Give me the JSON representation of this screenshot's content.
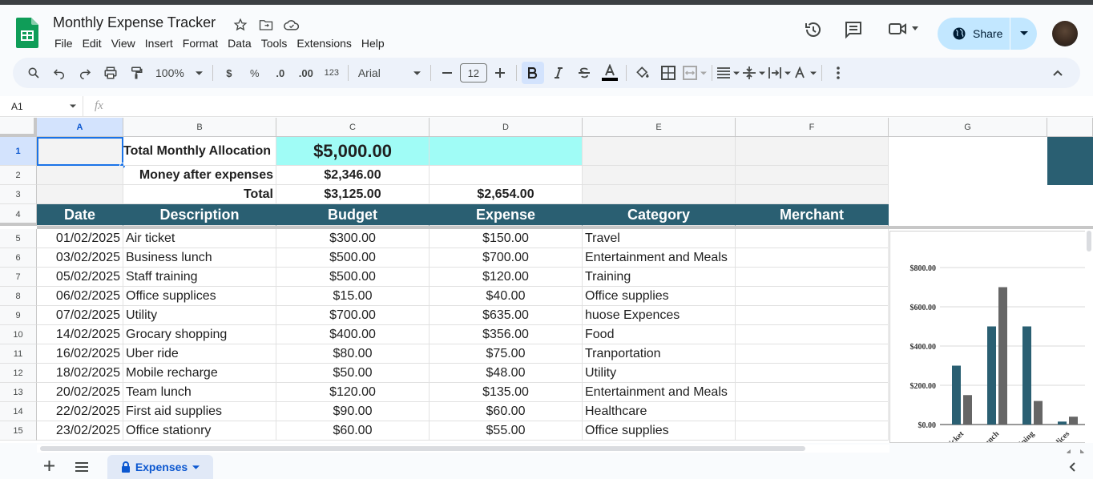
{
  "doc_title": "Monthly Expense Tracker",
  "menu": [
    "File",
    "Edit",
    "View",
    "Insert",
    "Format",
    "Data",
    "Tools",
    "Extensions",
    "Help"
  ],
  "share_label": "Share",
  "toolbar": {
    "zoom": "100%",
    "currency": "$",
    "percent": "%",
    "dec_dec": ".0",
    "inc_dec": ".00",
    "num_format": "123",
    "font": "Arial",
    "font_size": "12"
  },
  "formula_bar": {
    "name_box": "A1",
    "fx": "fx",
    "value": ""
  },
  "columns": [
    "A",
    "B",
    "C",
    "D",
    "E",
    "F",
    "G"
  ],
  "summary": [
    {
      "row": "1",
      "label": "Total Monthly Allocation",
      "c": "$5,000.00",
      "d": ""
    },
    {
      "row": "2",
      "label": "Money after expenses",
      "c": "$2,346.00",
      "d": ""
    },
    {
      "row": "3",
      "label": "Total",
      "c": "$3,125.00",
      "d": "$2,654.00"
    }
  ],
  "header_row": {
    "row": "4",
    "cells": [
      "Date",
      "Description",
      "Budget",
      "Expense",
      "Category",
      "Merchant"
    ]
  },
  "rows": [
    {
      "row": "5",
      "date": "01/02/2025",
      "desc": "Air ticket",
      "budget": "$300.00",
      "expense": "$150.00",
      "category": "Travel"
    },
    {
      "row": "6",
      "date": "03/02/2025",
      "desc": "Business lunch",
      "budget": "$500.00",
      "expense": "$700.00",
      "category": "Entertainment and Meals"
    },
    {
      "row": "7",
      "date": "05/02/2025",
      "desc": "Staff training",
      "budget": "$500.00",
      "expense": "$120.00",
      "category": "Training"
    },
    {
      "row": "8",
      "date": "06/02/2025",
      "desc": "Office supplices",
      "budget": "$15.00",
      "expense": "$40.00",
      "category": "Office supplies"
    },
    {
      "row": "9",
      "date": "07/02/2025",
      "desc": "Utility",
      "budget": "$700.00",
      "expense": "$635.00",
      "category": "huose Expences"
    },
    {
      "row": "10",
      "date": "14/02/2025",
      "desc": "Grocary shopping",
      "budget": "$400.00",
      "expense": "$356.00",
      "category": "Food"
    },
    {
      "row": "11",
      "date": "16/02/2025",
      "desc": "Uber ride",
      "budget": "$80.00",
      "expense": "$75.00",
      "category": "Tranportation"
    },
    {
      "row": "12",
      "date": "18/02/2025",
      "desc": "Mobile recharge",
      "budget": "$50.00",
      "expense": "$48.00",
      "category": "Utility"
    },
    {
      "row": "13",
      "date": "20/02/2025",
      "desc": "Team lunch",
      "budget": "$120.00",
      "expense": "$135.00",
      "category": "Entertainment and Meals"
    },
    {
      "row": "14",
      "date": "22/02/2025",
      "desc": "First aid supplies",
      "budget": "$90.00",
      "expense": "$60.00",
      "category": "Healthcare"
    },
    {
      "row": "15",
      "date": "23/02/2025",
      "desc": "Office stationry",
      "budget": "$60.00",
      "expense": "$55.00",
      "category": "Office supplies"
    }
  ],
  "chart_data": {
    "type": "bar",
    "categories": [
      "Air ticket",
      "Business lunch",
      "Staff training",
      "Office supplices"
    ],
    "category_labels_visible": [
      "icket",
      "unch",
      "ining",
      "lices"
    ],
    "series": [
      {
        "values": [
          300,
          500,
          500,
          15
        ],
        "color": "#2a5f72"
      },
      {
        "values": [
          150,
          700,
          120,
          40
        ],
        "color": "#666666"
      }
    ],
    "ylim": [
      0,
      800
    ],
    "yticks": [
      "$0.00",
      "$200.00",
      "$400.00",
      "$600.00",
      "$800.00"
    ],
    "grid": true
  },
  "sheet_tab": "Expenses",
  "colors": {
    "header_fill": "#2a5f72",
    "alloc_fill": "#a0fcf6",
    "accent": "#0b57d0"
  }
}
